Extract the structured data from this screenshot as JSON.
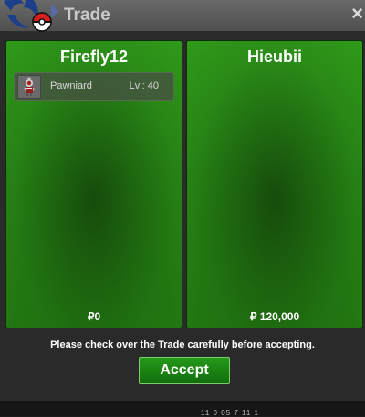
{
  "window": {
    "title": "Trade",
    "close_label": "×",
    "logo_icon": "pokeball-logo-icon"
  },
  "left_trader": {
    "name": "Firefly12",
    "items": [
      {
        "name": "Pawniard",
        "level": "Lvl: 40",
        "icon": "pawniard-sprite-icon"
      }
    ],
    "money": "₽0"
  },
  "right_trader": {
    "name": "Hieubii",
    "items": [],
    "money": "₽ 120,000"
  },
  "notice": "Please check over the Trade carefully before accepting.",
  "accept_label": "Accept",
  "bottom_strip_text": "11 0 05 7 11 1",
  "colors": {
    "panel_green": "#2f9a1a",
    "accept_green": "#1f8a16",
    "titlebar_gray": "#5c5c5c"
  }
}
